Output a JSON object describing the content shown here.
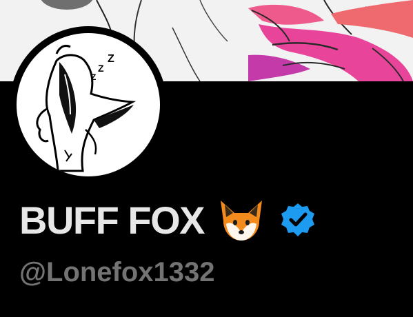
{
  "profile": {
    "display_name": "BUFF FOX",
    "handle": "@Lonefox1332",
    "name_emoji": "fox-face-icon",
    "verified": true
  },
  "colors": {
    "background": "#000000",
    "name_text": "#e7e7e7",
    "handle_text": "#737373",
    "verified_badge": "#1d9bf0",
    "banner_accent": "#e8459a"
  }
}
